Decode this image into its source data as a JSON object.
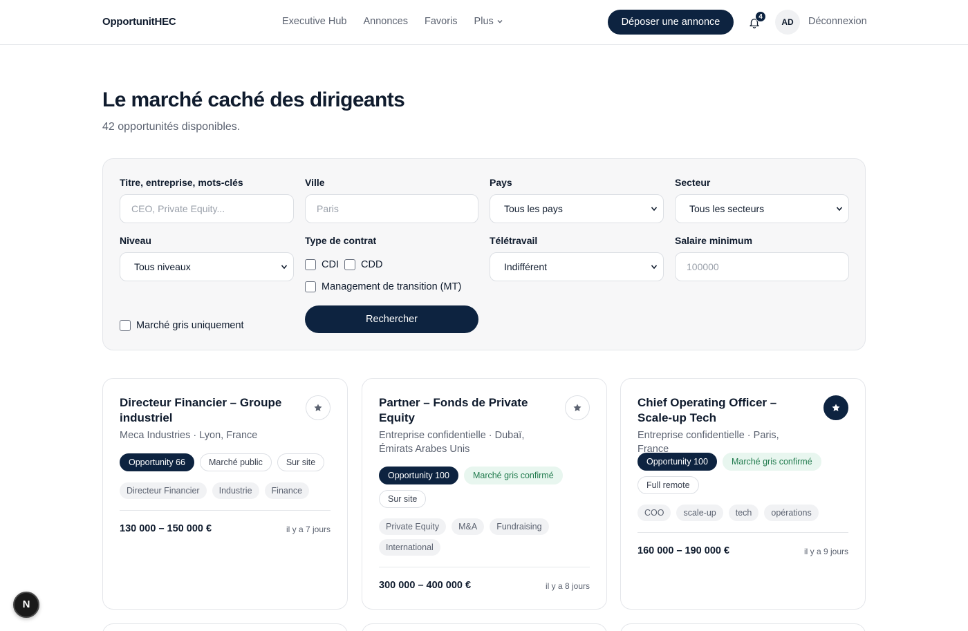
{
  "header": {
    "brand": "OpportunitHEC",
    "nav": [
      "Executive Hub",
      "Annonces",
      "Favoris",
      "Plus"
    ],
    "cta_label": "Déposer une annonce",
    "notification_count": "4",
    "avatar_initials": "AD",
    "logout_label": "Déconnexion"
  },
  "hero": {
    "title": "Le marché caché des dirigeants",
    "subtitle": "42 opportunités disponibles."
  },
  "filters": {
    "keywords_label": "Titre, entreprise, mots-clés",
    "keywords_placeholder": "CEO, Private Equity...",
    "city_label": "Ville",
    "city_placeholder": "Paris",
    "country_label": "Pays",
    "country_value": "Tous les pays",
    "sector_label": "Secteur",
    "sector_value": "Tous les secteurs",
    "level_label": "Niveau",
    "level_value": "Tous niveaux",
    "contract_label": "Type de contrat",
    "contract_options": [
      "CDI",
      "CDD",
      "Management de transition (MT)"
    ],
    "remote_label": "Télétravail",
    "remote_value": "Indifférent",
    "salary_label": "Salaire minimum",
    "salary_placeholder": "100000",
    "grey_market_label": "Marché gris uniquement",
    "search_button": "Rechercher"
  },
  "cards": [
    {
      "title": "Directeur Financier – Groupe industriel",
      "meta": "Meca Industries · Lyon, France",
      "favorited": false,
      "pills": [
        {
          "label": "Opportunity 66",
          "style": "dark"
        },
        {
          "label": "Marché public",
          "style": "outline"
        },
        {
          "label": "Sur site",
          "style": "outline"
        }
      ],
      "tags": [
        "Directeur Financier",
        "Industrie",
        "Finance"
      ],
      "salary": "130 000 – 150 000 €",
      "posted": "il y a 7 jours"
    },
    {
      "title": "Partner – Fonds de Private Equity",
      "meta": "Entreprise confidentielle · Dubaï, Émirats Arabes Unis",
      "favorited": false,
      "pills": [
        {
          "label": "Opportunity 100",
          "style": "dark"
        },
        {
          "label": "Marché gris confirmé",
          "style": "green"
        },
        {
          "label": "Sur site",
          "style": "outline"
        }
      ],
      "tags": [
        "Private Equity",
        "M&A",
        "Fundraising",
        "International"
      ],
      "salary": "300 000 – 400 000 €",
      "posted": "il y a 8 jours"
    },
    {
      "title": "Chief Operating Officer – Scale-up Tech",
      "meta": "Entreprise confidentielle · Paris, France",
      "favorited": true,
      "pills": [
        {
          "label": "Opportunity 100",
          "style": "dark"
        },
        {
          "label": "Marché gris confirmé",
          "style": "green"
        },
        {
          "label": "Full remote",
          "style": "outline"
        }
      ],
      "tags": [
        "COO",
        "scale-up",
        "tech",
        "opérations"
      ],
      "salary": "160 000 – 190 000 €",
      "posted": "il y a 9 jours"
    }
  ],
  "dev_badge": "N",
  "colors": {
    "primary": "#0d2340",
    "green_bg": "#e8f6ef",
    "green_text": "#1f7a4c",
    "panel_bg": "#f7f7f8"
  }
}
